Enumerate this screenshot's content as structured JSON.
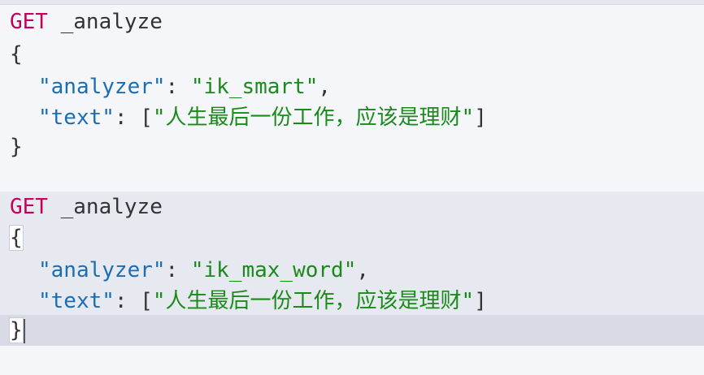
{
  "requests": [
    {
      "method": "GET",
      "path": "_analyze",
      "open_brace": "{",
      "close_brace": "}",
      "fields": [
        {
          "key": "\"analyzer\"",
          "sep": ": ",
          "value": "\"ik_smart\"",
          "tail": ","
        },
        {
          "key": "\"text\"",
          "sep": ": ",
          "open": "[",
          "value": "\"人生最后一份工作，应该是理财\"",
          "close": "]",
          "tail": ""
        }
      ]
    },
    {
      "method": "GET",
      "path": "_analyze",
      "open_brace": "{",
      "close_brace": "}",
      "fields": [
        {
          "key": "\"analyzer\"",
          "sep": ": ",
          "value": "\"ik_max_word\"",
          "tail": ","
        },
        {
          "key": "\"text\"",
          "sep": ": ",
          "open": "[",
          "value": "\"人生最后一份工作，应该是理财\"",
          "close": "]",
          "tail": ""
        }
      ]
    }
  ],
  "colors": {
    "method": "#c4005d",
    "key": "#1b6db3",
    "string": "#1a8a1a",
    "active_block": "#e7e9f0",
    "active_line": "#d8dbe5"
  }
}
